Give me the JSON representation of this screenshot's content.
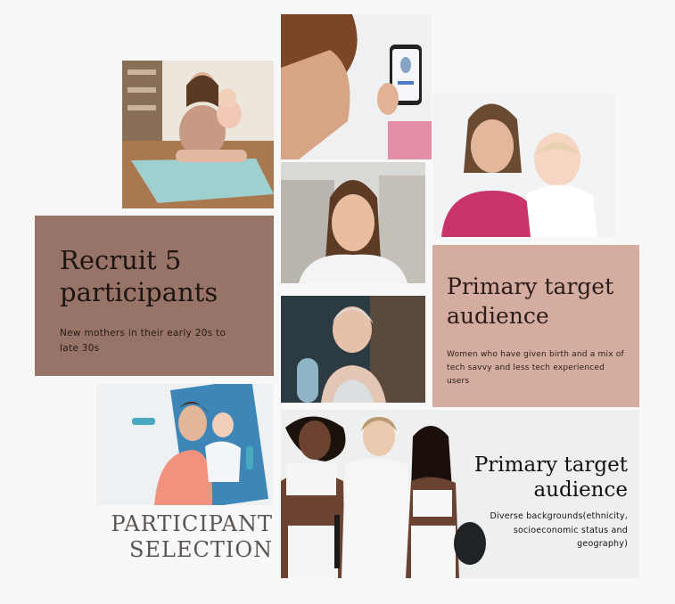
{
  "recruit": {
    "title_line1": "Recruit 5",
    "title_line2": "participants",
    "description": "New mothers in their early 20s to late 30s"
  },
  "primary_card": {
    "title_line1": "Primary target",
    "title_line2": "audience",
    "description": "Women who have given birth and a mix of tech savvy and less tech experienced users"
  },
  "diversity": {
    "title_line1": "Primary target",
    "title_line2": "audience",
    "description": "Diverse backgrounds(ethnicity, socioeconomic status and geography)"
  },
  "section_title": {
    "line1": "PARTICIPANT",
    "line2": "SELECTION"
  },
  "colors": {
    "background": "#f8f8f8",
    "recruit_card": "#987468",
    "primary_card": "#d4aca0",
    "section_title": "#5b5552"
  }
}
